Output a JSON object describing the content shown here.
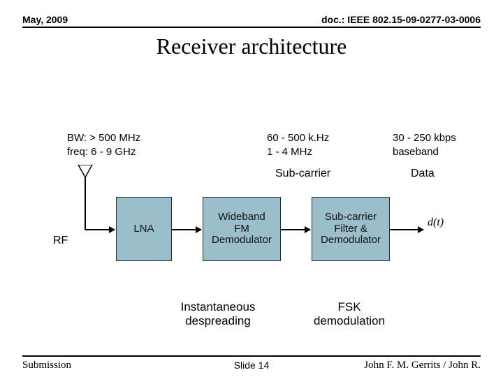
{
  "header": {
    "date": "May, 2009",
    "doc_ref": "doc.: IEEE 802.15-09-0277-03-0006"
  },
  "title": "Receiver architecture",
  "specs": {
    "rf": {
      "line1": "BW: > 500 MHz",
      "line2": "freq:  6 - 9 GHz"
    },
    "inter": {
      "line1": "60 - 500 k.Hz",
      "line2": "1 - 4 MHz"
    },
    "out": {
      "line1": "30 - 250 kbps",
      "line2": "baseband"
    }
  },
  "section_labels": {
    "subcarrier": "Sub-carrier",
    "data": "Data",
    "rf": "RF"
  },
  "blocks": {
    "lna": "LNA",
    "wfm": "Wideband\nFM\nDemodulator",
    "scfd": "Sub-carrier\nFilter &\nDemodulator"
  },
  "output_symbol": "d(t)",
  "bottom_labels": {
    "left": "Instantaneous\ndespreading",
    "right": "FSK\ndemodulation"
  },
  "footer": {
    "left": "Submission",
    "center": "Slide 14",
    "right": "John F. M. Gerrits / John R."
  }
}
